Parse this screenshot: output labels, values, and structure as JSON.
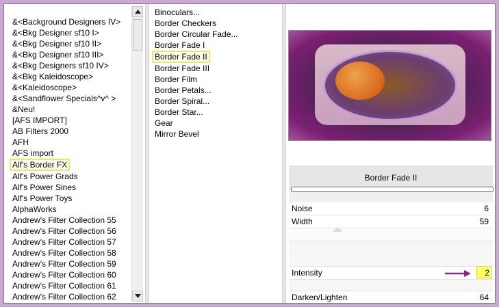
{
  "left_list": {
    "items": [
      "&<Background Designers IV>",
      "&<Bkg Designer sf10 I>",
      "&<Bkg Designer sf10 II>",
      "&<Bkg Designer sf10 III>",
      "&<Bkg Designers sf10 IV>",
      "&<Bkg Kaleidoscope>",
      "&<Kaleidoscope>",
      "&<Sandflower Specials^v^ >",
      "&Neu!",
      "[AFS IMPORT]",
      "AB Filters 2000",
      "AFH",
      "AFS import",
      "Alf's Border FX",
      "Alf's Power Grads",
      "Alf's Power Sines",
      "Alf's Power Toys",
      "AlphaWorks",
      "Andrew's Filter Collection 55",
      "Andrew's Filter Collection 56",
      "Andrew's Filter Collection 57",
      "Andrew's Filter Collection 58",
      "Andrew's Filter Collection 59",
      "Andrew's Filter Collection 60",
      "Andrew's Filter Collection 61",
      "Andrew's Filter Collection 62"
    ],
    "selected": "Alf's Border FX"
  },
  "mid_list": {
    "items": [
      "Binoculars...",
      "Border Checkers",
      "Border Circular Fade...",
      "Border Fade I",
      "Border Fade II",
      "Border Fade III",
      "Border Film",
      "Border Petals...",
      "Border Spiral...",
      "Border Star...",
      "Gear",
      "Mirror Bevel"
    ],
    "selected": "Border Fade II"
  },
  "params": {
    "title": "Border Fade II",
    "rows": [
      {
        "label": "Noise",
        "value": "6"
      },
      {
        "label": "Width",
        "value": "59"
      },
      {
        "label": "Intensity",
        "value": "2"
      },
      {
        "label": "Darken/Lighten",
        "value": "64"
      }
    ]
  },
  "colors": {
    "frame": "#c9a8d4",
    "highlight_border": "#ece47a",
    "value_highlight": "#ffff66",
    "arrow": "#7b2a86"
  }
}
